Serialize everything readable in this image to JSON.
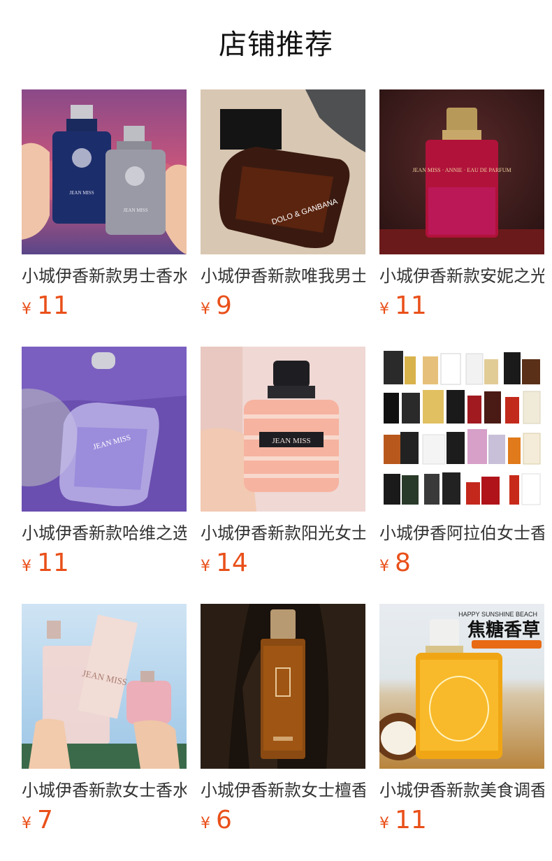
{
  "header": {
    "title": "店铺推荐"
  },
  "products": [
    {
      "name": "小城伊香新款男士香水",
      "currency": "¥",
      "price": "11",
      "image": "two-jean-miss-bottles-in-hands",
      "image_text": "JEAN MISS"
    },
    {
      "name": "小城伊香新款唯我男士",
      "currency": "¥",
      "price": "9",
      "image": "dark-square-bottle-on-stone",
      "image_text": "DOLO & GANBANA"
    },
    {
      "name": "小城伊香新款安妮之光",
      "currency": "¥",
      "price": "11",
      "image": "red-arabic-bottle",
      "image_text": "JEAN MISS · ANNIE · EAU DE PARFUM"
    },
    {
      "name": "小城伊香新款哈维之选",
      "currency": "¥",
      "price": "11",
      "image": "purple-glass-bottle",
      "image_text": "JEAN MISS"
    },
    {
      "name": "小城伊香新款阳光女士",
      "currency": "¥",
      "price": "14",
      "image": "pink-faceted-bottle-in-hand",
      "image_text": "JEAN MISS"
    },
    {
      "name": "小城伊香阿拉伯女士香",
      "currency": "¥",
      "price": "8",
      "image": "arabic-perfume-collage"
    },
    {
      "name": "小城伊香新款女士香水",
      "currency": "¥",
      "price": "7",
      "image": "pink-bottles-under-sky",
      "image_text": "JEAN MISS"
    },
    {
      "name": "小城伊香新款女士檀香",
      "currency": "¥",
      "price": "6",
      "image": "amber-sandalwood-bottle"
    },
    {
      "name": "小城伊香新款美食调香",
      "currency": "¥",
      "price": "11",
      "image": "caramel-vanilla-beach-bottle",
      "image_text": "HAPPY SUNSHINE BEACH",
      "image_headline": "焦糖香草"
    }
  ]
}
